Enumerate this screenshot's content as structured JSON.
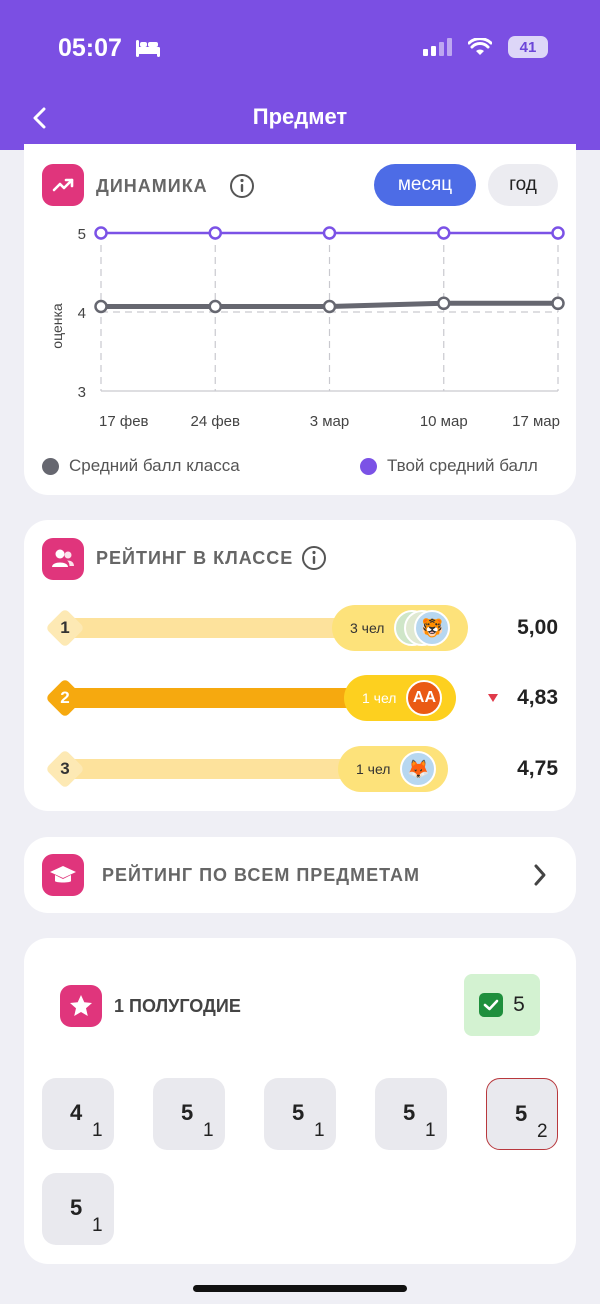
{
  "status_bar": {
    "time": "05:07",
    "battery": "41"
  },
  "header": {
    "title": "Предмет"
  },
  "dynamics": {
    "title": "ДИНАМИКА",
    "periods": [
      {
        "label": "месяц",
        "active": true
      },
      {
        "label": "год",
        "active": false
      }
    ],
    "legend": [
      {
        "label": "Средний балл класса",
        "color": "#666770"
      },
      {
        "label": "Твой средний балл",
        "color": "#7b52e6"
      }
    ]
  },
  "chart_data": {
    "type": "line",
    "ylabel": "оценка",
    "xlabel": "",
    "categories": [
      "17 фев",
      "24 фев",
      "3 мар",
      "10 мар",
      "17 мар"
    ],
    "y_ticks": [
      "5",
      "4",
      "3"
    ],
    "ylim": [
      3,
      5
    ],
    "series": [
      {
        "name": "Средний балл класса",
        "values": [
          4.07,
          4.07,
          4.07,
          4.11,
          4.11
        ],
        "color": "#666770"
      },
      {
        "name": "Твой средний балл",
        "values": [
          5.0,
          5.0,
          5.0,
          5.0,
          5.0
        ],
        "color": "#7b52e6"
      }
    ]
  },
  "class_rating": {
    "title": "РЕЙТИНГ В КЛАССЕ",
    "rows": [
      {
        "rank": "1",
        "count": "3 чел",
        "score": "5,00",
        "avatar": "🐯",
        "highlight": false
      },
      {
        "rank": "2",
        "count": "1 чел",
        "score": "4,83",
        "avatar": "АА",
        "highlight": true
      },
      {
        "rank": "3",
        "count": "1 чел",
        "score": "4,75",
        "avatar": "🦊",
        "highlight": false
      }
    ]
  },
  "all_subjects": {
    "title": "РЕЙТИНГ ПО ВСЕМ ПРЕДМЕТАМ"
  },
  "half_year": {
    "title": "1 ПОЛУГОДИЕ",
    "final_grade": "5",
    "grades": [
      {
        "value": "4",
        "weight": "1",
        "highlight": false
      },
      {
        "value": "5",
        "weight": "1",
        "highlight": false
      },
      {
        "value": "5",
        "weight": "1",
        "highlight": false
      },
      {
        "value": "5",
        "weight": "1",
        "highlight": false
      },
      {
        "value": "5",
        "weight": "2",
        "highlight": true
      },
      {
        "value": "5",
        "weight": "1",
        "highlight": false
      }
    ]
  }
}
